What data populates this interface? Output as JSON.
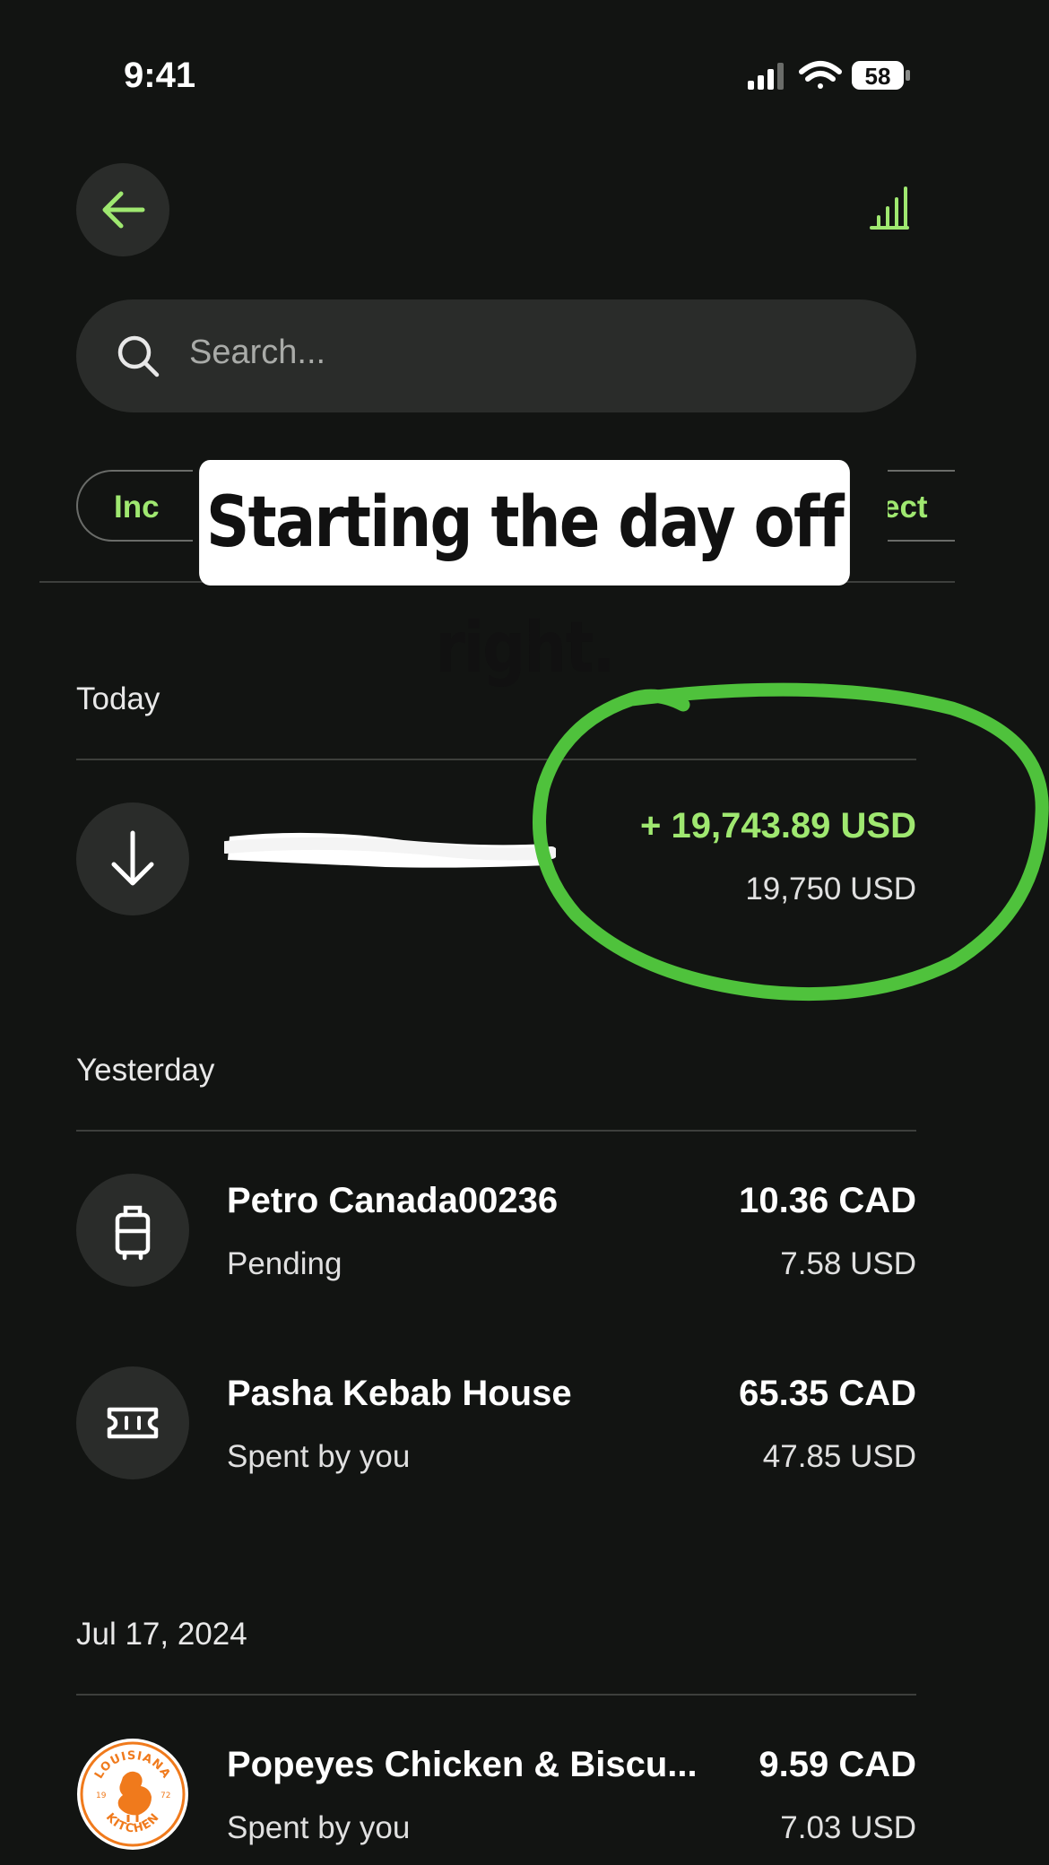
{
  "status": {
    "time": "9:41",
    "battery": "58",
    "icons": [
      "signal-icon",
      "wifi-icon",
      "battery-icon"
    ]
  },
  "nav": {
    "back_icon": "arrow-left-icon",
    "stats_icon": "bar-chart-icon"
  },
  "search": {
    "placeholder": "Search..."
  },
  "filters": {
    "left_partial": "Inc",
    "right_partial": "ect"
  },
  "caption": "Starting the day off right.",
  "sections": [
    {
      "label": "Today",
      "items": [
        {
          "icon": "arrow-down-icon",
          "name": "",
          "amount": "+ 19,743.89 USD",
          "secondary": "19,750 USD"
        }
      ]
    },
    {
      "label": "Yesterday",
      "items": [
        {
          "icon": "luggage-icon",
          "name": "Petro Canada00236",
          "status": "Pending",
          "amount": "10.36 CAD",
          "secondary": "7.58 USD"
        },
        {
          "icon": "ticket-icon",
          "name": "Pasha Kebab House",
          "status": "Spent by you",
          "amount": "65.35 CAD",
          "secondary": "47.85 USD"
        }
      ]
    },
    {
      "label": "Jul 17, 2024",
      "items": [
        {
          "icon": "popeyes-logo",
          "name": "Popeyes Chicken & Biscu...",
          "status": "Spent by you",
          "amount": "9.59 CAD",
          "secondary": "7.03 USD"
        }
      ]
    }
  ],
  "logo_text": {
    "top": "LOUISIANA",
    "bottom": "KITCHEN",
    "left": "19",
    "right": "72"
  },
  "colors": {
    "background": "#121412",
    "accent": "#9fe870",
    "annotation": "#4fc23c",
    "popeyes": "#f07a1c"
  }
}
